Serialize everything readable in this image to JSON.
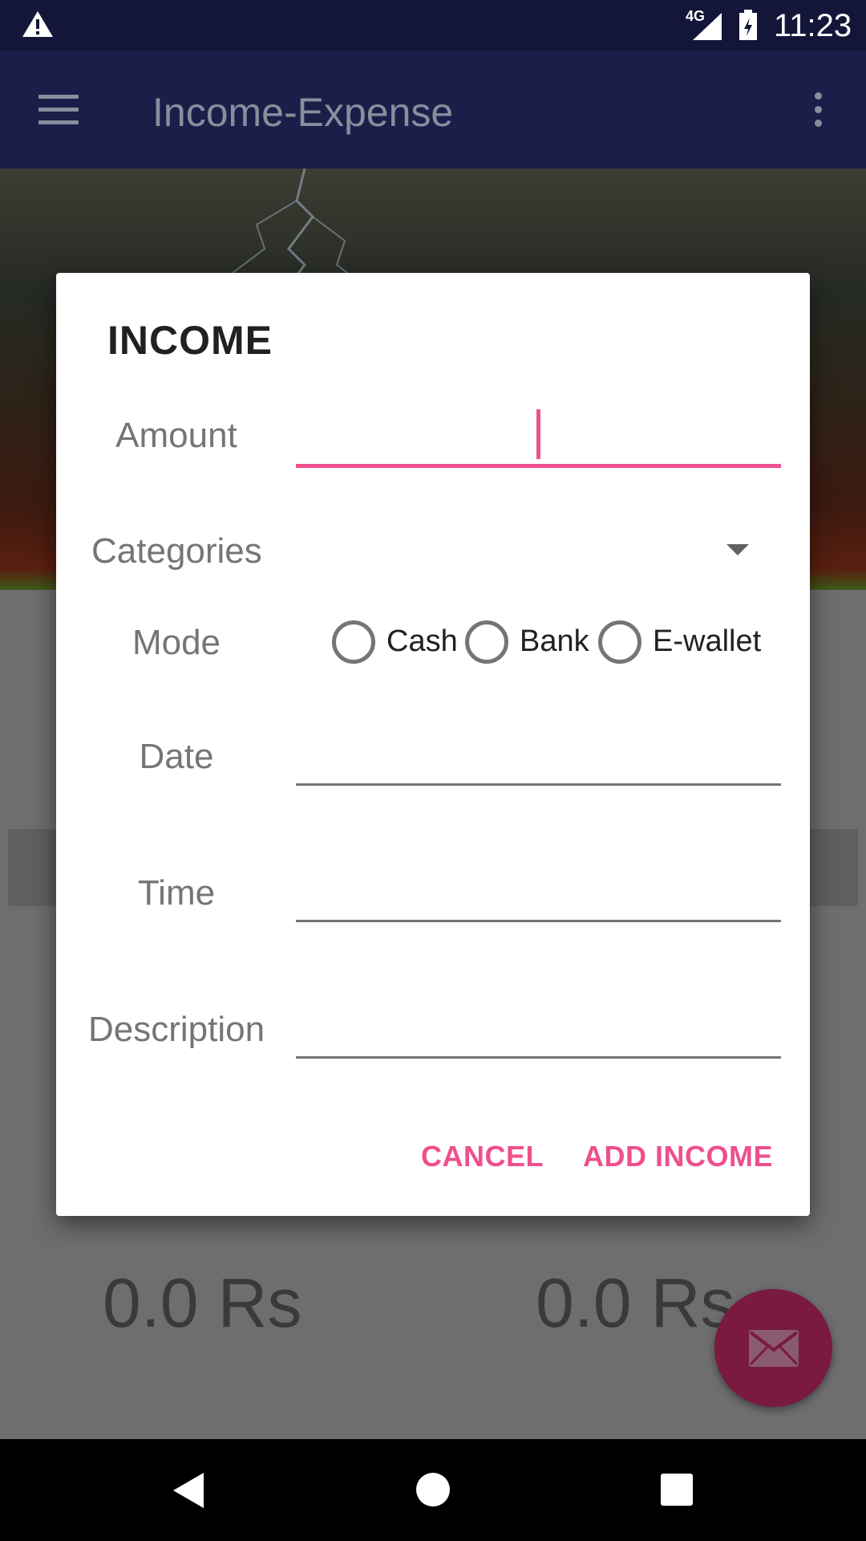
{
  "status_bar": {
    "network": "4G",
    "time": "11:23"
  },
  "app_bar": {
    "title": "Income-Expense"
  },
  "background": {
    "amount_left": "0.0 Rs",
    "amount_right": "0.0 Rs"
  },
  "dialog": {
    "title": "INCOME",
    "amount_label": "Amount",
    "amount_value": "",
    "categories_label": "Categories",
    "mode_label": "Mode",
    "mode_options": [
      "Cash",
      "Bank",
      "E-wallet"
    ],
    "date_label": "Date",
    "date_value": "",
    "time_label": "Time",
    "time_value": "",
    "description_label": "Description",
    "description_value": "",
    "cancel_label": "CANCEL",
    "add_label": "ADD INCOME"
  },
  "colors": {
    "accent": "#ef4f8d",
    "app_bar": "#1a1f4a",
    "status_bar": "#131638",
    "fab": "#7a1a40"
  },
  "icons": {
    "menu": "menu-icon",
    "more": "more-vert-icon",
    "fab": "envelope-icon",
    "warning": "warning-icon"
  }
}
